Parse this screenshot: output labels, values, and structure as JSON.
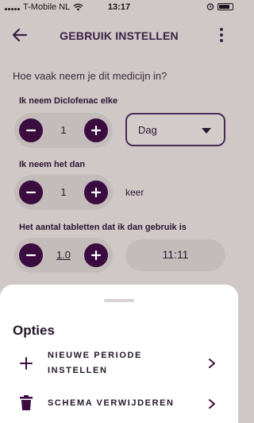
{
  "status": {
    "carrier": "T-Mobile NL",
    "time": "13:17"
  },
  "header": {
    "title": "GEBRUIK INSTELLEN"
  },
  "form": {
    "question": "Hoe vaak neem je dit medicijn in?",
    "frequency": {
      "label": "Ik neem Diclofenac elke",
      "value": "1",
      "period": "Dag"
    },
    "times": {
      "label": "Ik neem het dan",
      "value": "1",
      "unit": "keer"
    },
    "dose": {
      "label": "Het aantal tabletten dat ik dan gebruik is",
      "value": "1.0",
      "time": "11:11"
    }
  },
  "sheet": {
    "title": "Opties",
    "options": [
      {
        "label_line1": "NIEUWE PERIODE",
        "label_line2": "INSTELLEN",
        "icon": "plus-icon"
      },
      {
        "label_line1": "SCHEMA VERWIJDEREN",
        "icon": "trash-icon"
      }
    ]
  },
  "colors": {
    "primary": "#3a0c3f",
    "background_dimmed": "#cfc8c6",
    "sheet": "#ffffff"
  }
}
